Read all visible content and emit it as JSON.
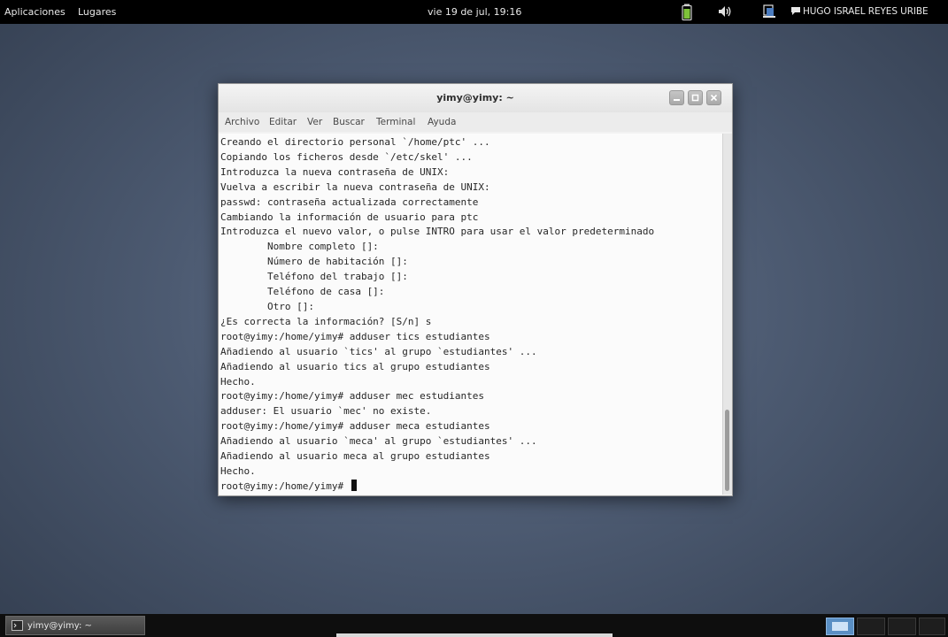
{
  "top_panel": {
    "applications_label": "Aplicaciones",
    "places_label": "Lugares",
    "clock": "vie 19 de jul, 19:16",
    "user_name": "HUGO ISRAEL REYES URIBE",
    "icons": [
      "battery-icon",
      "volume-icon",
      "user-switch-icon",
      "chat-icon"
    ]
  },
  "window": {
    "title": "yimy@yimy: ~",
    "menu": {
      "archivo": "Archivo",
      "editar": "Editar",
      "ver": "Ver",
      "buscar": "Buscar",
      "terminal": "Terminal",
      "ayuda": "Ayuda"
    },
    "lines": [
      "Creando el directorio personal `/home/ptc' ...",
      "Copiando los ficheros desde `/etc/skel' ...",
      "Introduzca la nueva contraseña de UNIX:",
      "Vuelva a escribir la nueva contraseña de UNIX:",
      "passwd: contraseña actualizada correctamente",
      "Cambiando la información de usuario para ptc",
      "Introduzca el nuevo valor, o pulse INTRO para usar el valor predeterminado",
      "        Nombre completo []:",
      "        Número de habitación []:",
      "        Teléfono del trabajo []:",
      "        Teléfono de casa []:",
      "        Otro []:",
      "¿Es correcta la información? [S/n] s",
      "root@yimy:/home/yimy# adduser tics estudiantes",
      "Añadiendo al usuario `tics' al grupo `estudiantes' ...",
      "Añadiendo al usuario tics al grupo estudiantes",
      "Hecho.",
      "root@yimy:/home/yimy# adduser mec estudiantes",
      "adduser: El usuario `mec' no existe.",
      "root@yimy:/home/yimy# adduser meca estudiantes",
      "Añadiendo al usuario `meca' al grupo `estudiantes' ...",
      "Añadiendo al usuario meca al grupo estudiantes",
      "Hecho.",
      "root@yimy:/home/yimy# "
    ]
  },
  "bottom_panel": {
    "task_label": "yimy@yimy: ~"
  },
  "colors": {
    "panel": "#000000",
    "workspace_active": "#5a8fc4",
    "terminal_bg": "#fbfbfb",
    "terminal_fg": "#262626"
  }
}
